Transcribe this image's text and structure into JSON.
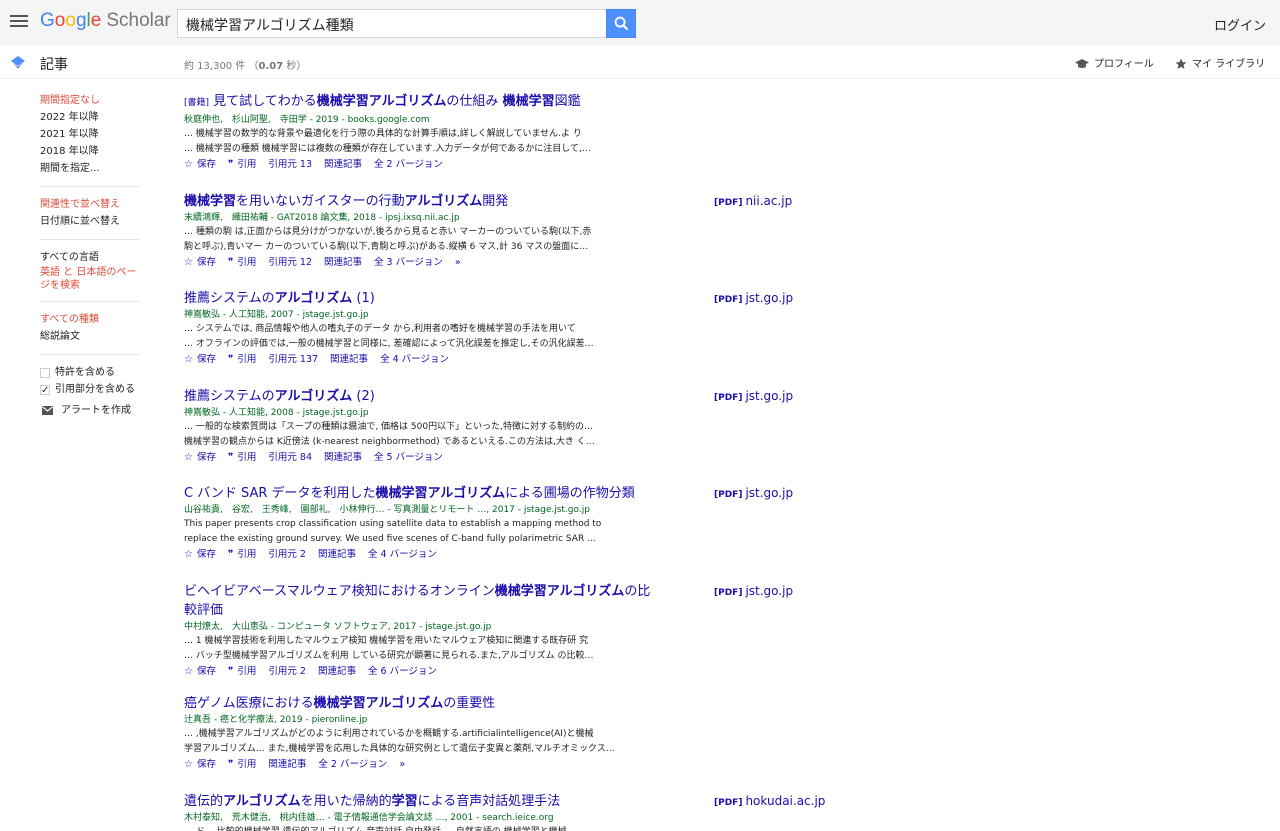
{
  "header": {
    "logo_google": "Google",
    "logo_scholar": "Scholar",
    "search_value": "機械学習アルゴリズム種類",
    "login_label": "ログイン"
  },
  "subheader": {
    "section_label": "記事",
    "result_count_prefix": "約 13,300 件 （",
    "result_time": "0.07",
    "result_count_suffix": " 秒）",
    "profile_label": "プロフィール",
    "library_label": "マイ ライブラリ"
  },
  "sidebar": {
    "time_filters": [
      "期間指定なし",
      "2022 年以降",
      "2021 年以降",
      "2018 年以降",
      "期間を指定..."
    ],
    "sort_filters": [
      "関連性で並べ替え",
      "日付順に並べ替え"
    ],
    "language_filters": [
      "すべての言語",
      "英語 と 日本語のページを検索"
    ],
    "type_filters": [
      "すべての種類",
      "総説論文"
    ],
    "include_patents": "特許を含める",
    "include_citations": "引用部分を含める",
    "alert_label": "アラートを作成"
  },
  "results": [
    {
      "tag": "[書籍]",
      "title_parts": [
        "見て試してわかる",
        "機械学習アルゴリズム",
        "の仕組み ",
        "機械学習",
        "図鑑"
      ],
      "authors": "秋庭伸也,　杉山阿聖,　寺田学 - 2019 - books.google.com",
      "snippet1": "… 機械学習の数学的な背景や最適化を行う際の具体的な計算手順は,詳しく解説していません.よ り",
      "snippet2": "… 機械学習の種類 機械学習には複数の種類が存在しています.入力データが何であるかに注目して,…",
      "actions": [
        "保存",
        "引用",
        "引用元 13",
        "関連記事",
        "全 2 バージョン"
      ],
      "pdf": ""
    },
    {
      "tag": "",
      "title_parts": [
        "",
        "機械学習",
        "を用いないガイスターの行動",
        "アルゴリズム",
        "開発"
      ],
      "authors": "末續鴻輝,　織田祐輔 - GAT2018 論文集, 2018 - ipsj.ixsq.nii.ac.jp",
      "snippet1": "… 種類の駒 は,正面からは見分けがつかないが,後ろから見ると赤い マーカーのついている駒(以下,赤",
      "snippet2": "駒と呼ぶ),青いマー カーのついている駒(以下,青駒と呼ぶ)がある.縦横 6 マス,計 36 マスの盤面に…",
      "actions": [
        "保存",
        "引用",
        "引用元 12",
        "関連記事",
        "全 3 バージョン"
      ],
      "pdf": "nii.ac.jp"
    },
    {
      "tag": "",
      "title_parts": [
        "推薦システムの",
        "アルゴリズム",
        " (1)",
        "",
        ""
      ],
      "authors": "神嶌敏弘 - 人工知能, 2007 - jstage.jst.go.jp",
      "snippet1": "… システムでは, 商品情報や他人の嗜丸子のデータ から,利用者の嗜好を機械学習の手法を用いて",
      "snippet2": "… オフラインの評価では,一般の機械学習と同様に, 差確認によって汎化誤差を推定し,その汎化誤差…",
      "actions": [
        "保存",
        "引用",
        "引用元 137",
        "関連記事",
        "全 4 バージョン"
      ],
      "pdf": "jst.go.jp"
    },
    {
      "tag": "",
      "title_parts": [
        "推薦システムの",
        "アルゴリズム",
        " (2)",
        "",
        ""
      ],
      "authors": "神嶌敏弘 - 人工知能, 2008 - jstage.jst.go.jp",
      "snippet1": "… 一般的な検索質問は「スープの種類は醤油で, 価格は 500円以下」といった,特徴に対する制約の…",
      "snippet2": "機械学習の観点からは K近傍法 (k-nearest neighbormethod) であるといえる.この方法は,大き く…",
      "actions": [
        "保存",
        "引用",
        "引用元 84",
        "関連記事",
        "全 5 バージョン"
      ],
      "pdf": "jst.go.jp"
    },
    {
      "tag": "",
      "title_parts": [
        "C バンド SAR データを利用した",
        "機械学習アルゴリズム",
        "による圃場の作物分類",
        "",
        ""
      ],
      "authors": "山谷祐貴,　谷宏,　王秀峰,　園部礼,　小林伸行… - 写真測量とリモート …, 2017 - jstage.jst.go.jp",
      "snippet1": "This paper presents crop classification using satellite data to establish a mapping method to",
      "snippet2": "replace the existing ground survey. We used five scenes of C-band fully polarimetric SAR …",
      "actions": [
        "保存",
        "引用",
        "引用元 2",
        "関連記事",
        "全 4 バージョン"
      ],
      "pdf": "jst.go.jp"
    },
    {
      "tag": "",
      "title_parts": [
        "ビヘイビアベースマルウェア検知におけるオンライン",
        "機械学習アルゴリズム",
        "の比較評価",
        "",
        ""
      ],
      "authors": "中村燎太,　大山恵弘 - コンピュータ ソフトウェア, 2017 - jstage.jst.go.jp",
      "snippet1": "… 1 機械学習技術を利用したマルウェア検知 機械学習を用いたマルウェア検知に関連する既存研 究",
      "snippet2": "… バッチ型機械学習アルゴリズムを利用 している研究が顕著に見られる.また,アルゴリズム の比較…",
      "actions": [
        "保存",
        "引用",
        "引用元 2",
        "関連記事",
        "全 6 バージョン"
      ],
      "pdf": "jst.go.jp"
    },
    {
      "tag": "",
      "title_parts": [
        "癌ゲノム医療における",
        "機械学習アルゴリズム",
        "の重要性",
        "",
        ""
      ],
      "authors": "辻真吾 - 癌と化学療法, 2019 - pieronline.jp",
      "snippet1": "… ,機械学習アルゴリズムがどのように利用されているかを概観する.artificialintelligence(AI)と機械",
      "snippet2": "学習アルゴリズム… また,機械学習を応用した具体的な研究例として遺伝子変異と薬剤,マルチオミックス…",
      "actions": [
        "保存",
        "引用",
        "関連記事",
        "全 2 バージョン"
      ],
      "pdf": ""
    },
    {
      "tag": "",
      "title_parts": [
        "遺伝的",
        "アルゴリズム",
        "を用いた帰納的",
        "学習",
        "による音声対話処理手法"
      ],
      "authors": "木村泰知,　荒木健治,　桃内佳雄… - 電子情報通信学会論文誌 …, 2001 - search.ieice.org",
      "snippet1": "… ド… 比較的機械学習 遺伝的アルゴリズム 音声対話 自由発話 … 自然言語の 機械学習と機械",
      "snippet2": "",
      "actions": [],
      "pdf": "hokudai.ac.jp"
    }
  ]
}
